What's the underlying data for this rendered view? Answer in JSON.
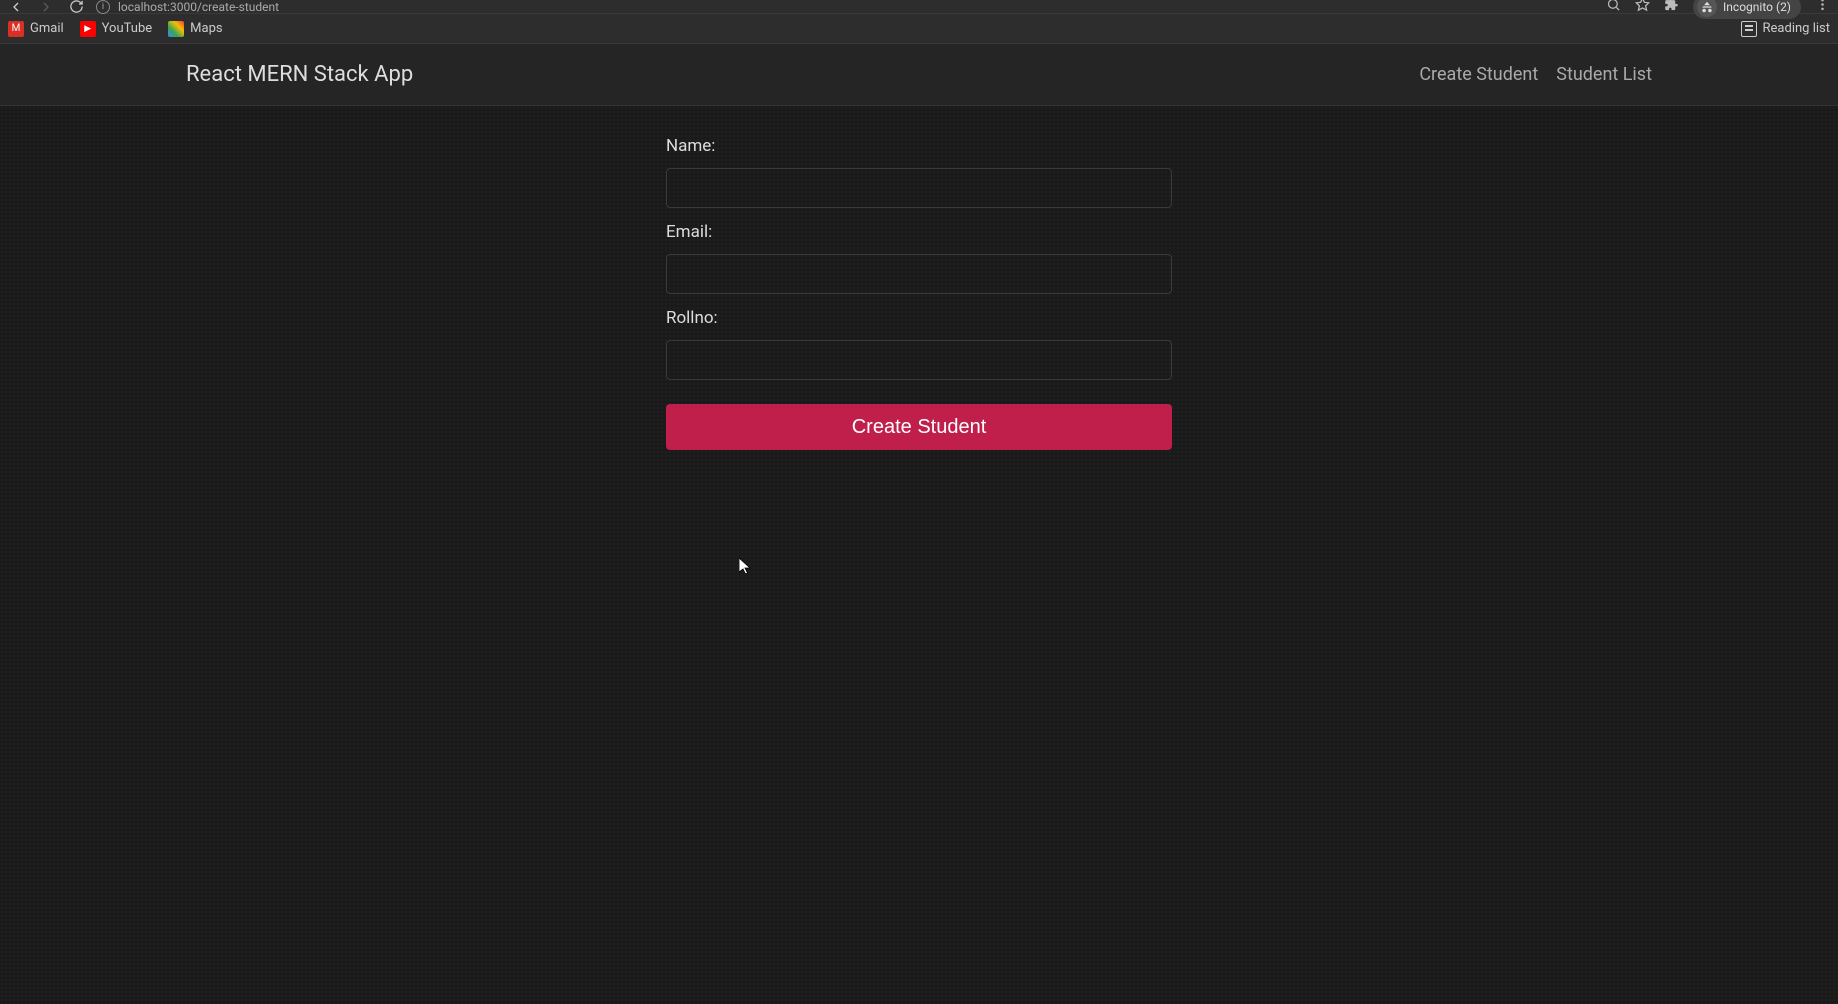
{
  "browser": {
    "url": "localhost:3000/create-student",
    "incognito_label": "Incognito (2)"
  },
  "bookmarks": {
    "gmail": "Gmail",
    "youtube": "YouTube",
    "maps": "Maps",
    "reading_list": "Reading list"
  },
  "navbar": {
    "brand": "React MERN Stack App",
    "links": {
      "create": "Create Student",
      "list": "Student List"
    }
  },
  "form": {
    "name_label": "Name:",
    "name_value": "",
    "email_label": "Email:",
    "email_value": "",
    "rollno_label": "Rollno:",
    "rollno_value": "",
    "submit_label": "Create Student"
  }
}
